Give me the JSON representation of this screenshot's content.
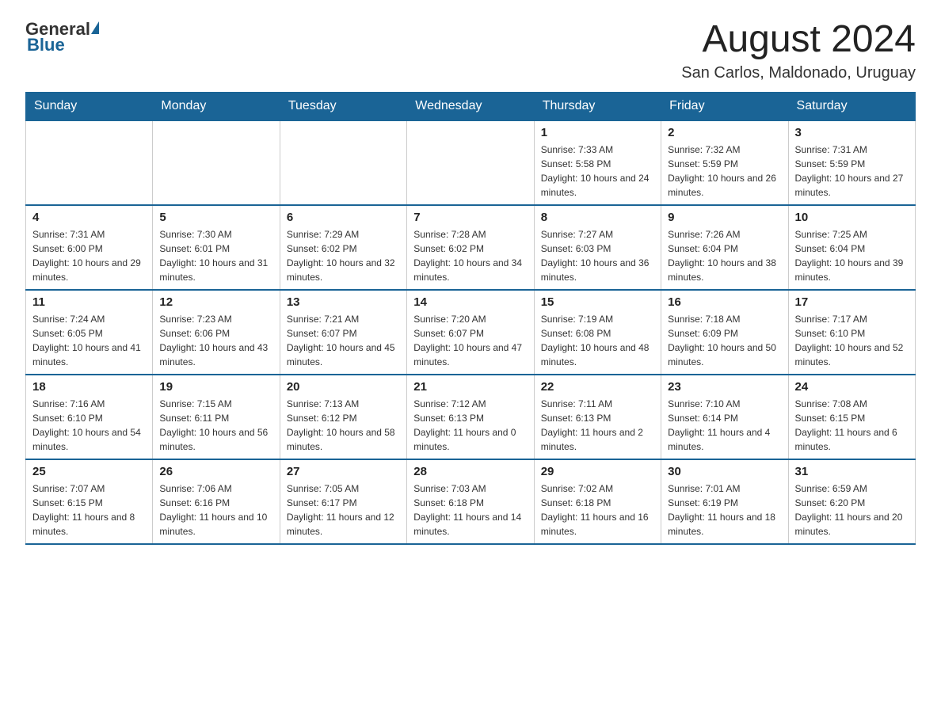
{
  "header": {
    "logo_general": "General",
    "logo_blue": "Blue",
    "month_title": "August 2024",
    "location": "San Carlos, Maldonado, Uruguay"
  },
  "days_of_week": [
    "Sunday",
    "Monday",
    "Tuesday",
    "Wednesday",
    "Thursday",
    "Friday",
    "Saturday"
  ],
  "weeks": [
    [
      {
        "day": "",
        "info": ""
      },
      {
        "day": "",
        "info": ""
      },
      {
        "day": "",
        "info": ""
      },
      {
        "day": "",
        "info": ""
      },
      {
        "day": "1",
        "info": "Sunrise: 7:33 AM\nSunset: 5:58 PM\nDaylight: 10 hours and 24 minutes."
      },
      {
        "day": "2",
        "info": "Sunrise: 7:32 AM\nSunset: 5:59 PM\nDaylight: 10 hours and 26 minutes."
      },
      {
        "day": "3",
        "info": "Sunrise: 7:31 AM\nSunset: 5:59 PM\nDaylight: 10 hours and 27 minutes."
      }
    ],
    [
      {
        "day": "4",
        "info": "Sunrise: 7:31 AM\nSunset: 6:00 PM\nDaylight: 10 hours and 29 minutes."
      },
      {
        "day": "5",
        "info": "Sunrise: 7:30 AM\nSunset: 6:01 PM\nDaylight: 10 hours and 31 minutes."
      },
      {
        "day": "6",
        "info": "Sunrise: 7:29 AM\nSunset: 6:02 PM\nDaylight: 10 hours and 32 minutes."
      },
      {
        "day": "7",
        "info": "Sunrise: 7:28 AM\nSunset: 6:02 PM\nDaylight: 10 hours and 34 minutes."
      },
      {
        "day": "8",
        "info": "Sunrise: 7:27 AM\nSunset: 6:03 PM\nDaylight: 10 hours and 36 minutes."
      },
      {
        "day": "9",
        "info": "Sunrise: 7:26 AM\nSunset: 6:04 PM\nDaylight: 10 hours and 38 minutes."
      },
      {
        "day": "10",
        "info": "Sunrise: 7:25 AM\nSunset: 6:04 PM\nDaylight: 10 hours and 39 minutes."
      }
    ],
    [
      {
        "day": "11",
        "info": "Sunrise: 7:24 AM\nSunset: 6:05 PM\nDaylight: 10 hours and 41 minutes."
      },
      {
        "day": "12",
        "info": "Sunrise: 7:23 AM\nSunset: 6:06 PM\nDaylight: 10 hours and 43 minutes."
      },
      {
        "day": "13",
        "info": "Sunrise: 7:21 AM\nSunset: 6:07 PM\nDaylight: 10 hours and 45 minutes."
      },
      {
        "day": "14",
        "info": "Sunrise: 7:20 AM\nSunset: 6:07 PM\nDaylight: 10 hours and 47 minutes."
      },
      {
        "day": "15",
        "info": "Sunrise: 7:19 AM\nSunset: 6:08 PM\nDaylight: 10 hours and 48 minutes."
      },
      {
        "day": "16",
        "info": "Sunrise: 7:18 AM\nSunset: 6:09 PM\nDaylight: 10 hours and 50 minutes."
      },
      {
        "day": "17",
        "info": "Sunrise: 7:17 AM\nSunset: 6:10 PM\nDaylight: 10 hours and 52 minutes."
      }
    ],
    [
      {
        "day": "18",
        "info": "Sunrise: 7:16 AM\nSunset: 6:10 PM\nDaylight: 10 hours and 54 minutes."
      },
      {
        "day": "19",
        "info": "Sunrise: 7:15 AM\nSunset: 6:11 PM\nDaylight: 10 hours and 56 minutes."
      },
      {
        "day": "20",
        "info": "Sunrise: 7:13 AM\nSunset: 6:12 PM\nDaylight: 10 hours and 58 minutes."
      },
      {
        "day": "21",
        "info": "Sunrise: 7:12 AM\nSunset: 6:13 PM\nDaylight: 11 hours and 0 minutes."
      },
      {
        "day": "22",
        "info": "Sunrise: 7:11 AM\nSunset: 6:13 PM\nDaylight: 11 hours and 2 minutes."
      },
      {
        "day": "23",
        "info": "Sunrise: 7:10 AM\nSunset: 6:14 PM\nDaylight: 11 hours and 4 minutes."
      },
      {
        "day": "24",
        "info": "Sunrise: 7:08 AM\nSunset: 6:15 PM\nDaylight: 11 hours and 6 minutes."
      }
    ],
    [
      {
        "day": "25",
        "info": "Sunrise: 7:07 AM\nSunset: 6:15 PM\nDaylight: 11 hours and 8 minutes."
      },
      {
        "day": "26",
        "info": "Sunrise: 7:06 AM\nSunset: 6:16 PM\nDaylight: 11 hours and 10 minutes."
      },
      {
        "day": "27",
        "info": "Sunrise: 7:05 AM\nSunset: 6:17 PM\nDaylight: 11 hours and 12 minutes."
      },
      {
        "day": "28",
        "info": "Sunrise: 7:03 AM\nSunset: 6:18 PM\nDaylight: 11 hours and 14 minutes."
      },
      {
        "day": "29",
        "info": "Sunrise: 7:02 AM\nSunset: 6:18 PM\nDaylight: 11 hours and 16 minutes."
      },
      {
        "day": "30",
        "info": "Sunrise: 7:01 AM\nSunset: 6:19 PM\nDaylight: 11 hours and 18 minutes."
      },
      {
        "day": "31",
        "info": "Sunrise: 6:59 AM\nSunset: 6:20 PM\nDaylight: 11 hours and 20 minutes."
      }
    ]
  ]
}
